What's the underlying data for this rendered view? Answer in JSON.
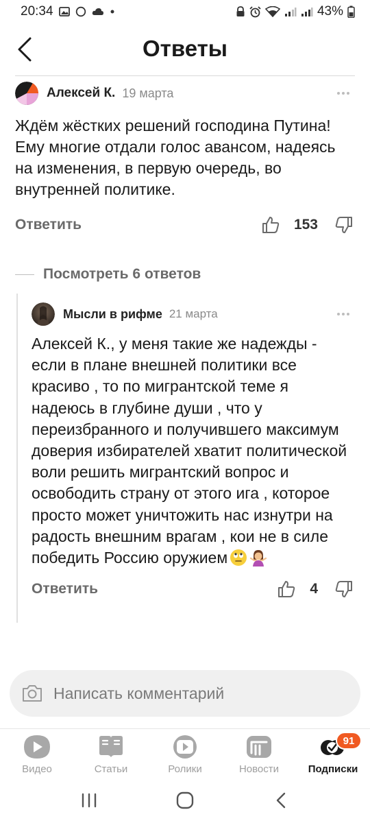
{
  "status_bar": {
    "time": "20:34",
    "battery": "43%"
  },
  "header": {
    "title": "Ответы"
  },
  "comment": {
    "author": "Алексей К.",
    "date": "19 марта",
    "text": "Ждём жёстких решений господина Путина! Ему многие отдали голос авансом, надеясь на изменения, в первую очередь, во внутренней политике.",
    "reply_label": "Ответить",
    "likes": "153"
  },
  "show_replies": "Посмотреть 6 ответов",
  "reply": {
    "author": "Мысли в рифме",
    "date": "21 марта",
    "text": "Алексей К., у меня такие же надежды - если в плане внешней политики все красиво , то по мигрантской теме я надеюсь в глубине души , что у переизбранного и получившего максимум доверия избирателей хватит политической воли решить мигрантский вопрос и освободить страну от этого ига , которое просто может уничтожить нас изнутри на радость внешним врагам , кои не в силе победить Россию оружием",
    "emojis": [
      "face-with-rolling-eyes",
      "woman-shrugging"
    ],
    "reply_label": "Ответить",
    "likes": "4"
  },
  "comment_input": {
    "placeholder": "Написать комментарий"
  },
  "bottom_nav": {
    "items": [
      {
        "label": "Видео",
        "icon": "video-icon"
      },
      {
        "label": "Статьи",
        "icon": "articles-icon"
      },
      {
        "label": "Ролики",
        "icon": "shorts-icon"
      },
      {
        "label": "Новости",
        "icon": "news-icon"
      },
      {
        "label": "Подписки",
        "icon": "subscriptions-icon",
        "active": true,
        "badge": "91"
      }
    ]
  },
  "colors": {
    "accent": "#f05a22",
    "text": "#1a1a1a",
    "muted": "#6a6a6a"
  }
}
